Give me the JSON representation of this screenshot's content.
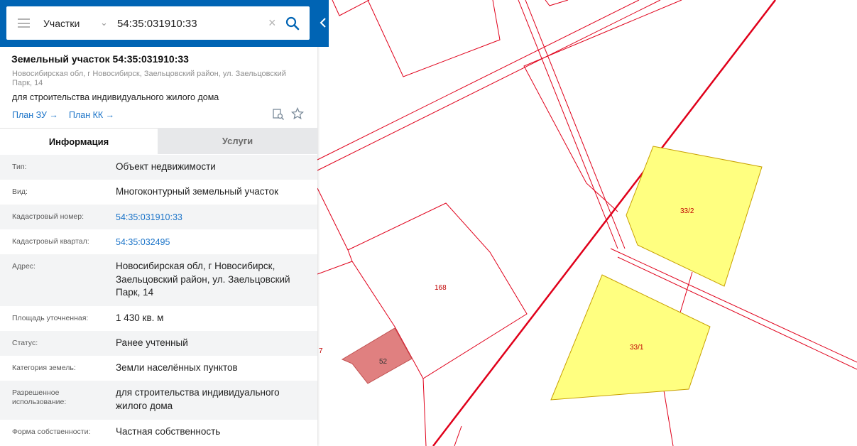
{
  "search": {
    "category": "Участки",
    "query": "54:35:031910:33"
  },
  "parcel": {
    "title": "Земельный участок 54:35:031910:33",
    "address": "Новосибирская обл, г Новосибирск, Заельцовский район, ул. Заельцовский Парк, 14",
    "purpose": "для строительства индивидуального жилого дома",
    "links": [
      "План ЗУ →",
      "План КК →"
    ]
  },
  "tabs": [
    "Информация",
    "Услуги"
  ],
  "info_rows": [
    {
      "label": "Тип:",
      "value": "Объект недвижимости"
    },
    {
      "label": "Вид:",
      "value": "Многоконтурный земельный участок"
    },
    {
      "label": "Кадастровый номер:",
      "value": "54:35:031910:33"
    },
    {
      "label": "Кадастровый квартал:",
      "value": "54:35:032495"
    },
    {
      "label": "Адрес:",
      "value": "Новосибирская обл, г Новосибирск, Заельцовский район, ул. Заельцовский Парк, 14"
    },
    {
      "label": "Площадь уточненная:",
      "value": "1 430 кв. м"
    },
    {
      "label": "Статус:",
      "value": "Ранее учтенный"
    },
    {
      "label": "Категория земель:",
      "value": "Земли населённых пунктов"
    },
    {
      "label": "Разрешенное использование:",
      "value": "для строительства индивидуального жилого дома"
    },
    {
      "label": "Форма собственности:",
      "value": "Частная собственность"
    }
  ],
  "map_labels": {
    "contour_2": "33/2",
    "contour_1": "33/1",
    "parcel_168": "168",
    "building_52": "52",
    "edge_7": "7"
  },
  "colors": {
    "accent": "#0064b4",
    "link": "#1a73c8",
    "boundary": "#e0001a",
    "highlight_fill": "#ffff80",
    "highlight_stroke": "#d4a000",
    "building_fill": "#e08080"
  },
  "icons": {
    "menu": "menu-icon",
    "dropdown": "chevron-down-icon",
    "clear": "close-icon",
    "search": "search-icon",
    "collapse": "chevron-left-icon",
    "plan_preview": "document-search-icon",
    "favorite": "star-icon"
  }
}
